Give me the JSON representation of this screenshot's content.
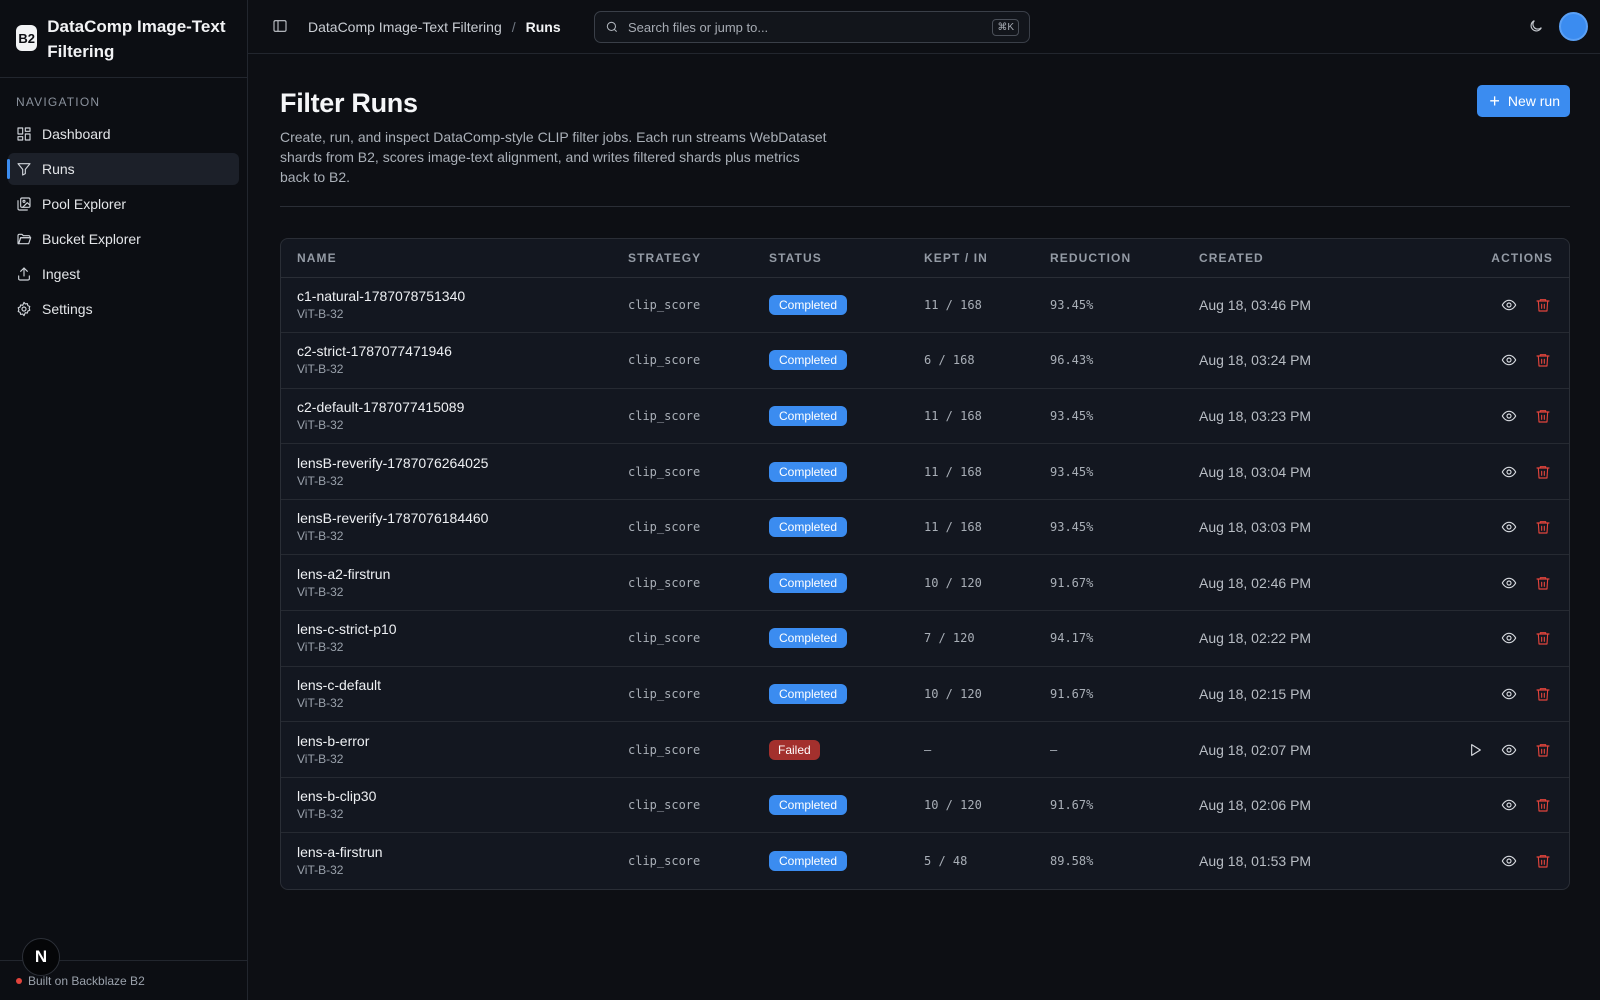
{
  "app": {
    "logo_text": "B2",
    "title": "DataComp Image-Text Filtering"
  },
  "sidebar": {
    "heading": "NAVIGATION",
    "items": [
      {
        "label": "Dashboard",
        "icon": "dashboard-icon",
        "active": false
      },
      {
        "label": "Runs",
        "icon": "filter-icon",
        "active": true
      },
      {
        "label": "Pool Explorer",
        "icon": "images-icon",
        "active": false
      },
      {
        "label": "Bucket Explorer",
        "icon": "folder-icon",
        "active": false
      },
      {
        "label": "Ingest",
        "icon": "upload-icon",
        "active": false
      },
      {
        "label": "Settings",
        "icon": "gear-icon",
        "active": false
      }
    ],
    "footer": "Built on Backblaze B2",
    "n_badge": "N"
  },
  "topbar": {
    "breadcrumb_root": "DataComp Image-Text Filtering",
    "breadcrumb_sep": "/",
    "breadcrumb_current": "Runs",
    "search_placeholder": "Search files or jump to...",
    "search_shortcut": "⌘K"
  },
  "page": {
    "title": "Filter Runs",
    "description": "Create, run, and inspect DataComp-style CLIP filter jobs. Each run streams WebDataset shards from B2, scores image-text alignment, and writes filtered shards plus metrics back to B2.",
    "new_run_label": "New run"
  },
  "table": {
    "columns": [
      "NAME",
      "STRATEGY",
      "STATUS",
      "KEPT / IN",
      "REDUCTION",
      "CREATED",
      "ACTIONS"
    ],
    "rows": [
      {
        "name": "c1-natural-1787078751340",
        "model": "ViT-B-32",
        "strategy": "clip_score",
        "status": "Completed",
        "kept_in": "11 / 168",
        "reduction": "93.45%",
        "created": "Aug 18, 03:46 PM",
        "can_rerun": false
      },
      {
        "name": "c2-strict-1787077471946",
        "model": "ViT-B-32",
        "strategy": "clip_score",
        "status": "Completed",
        "kept_in": "6 / 168",
        "reduction": "96.43%",
        "created": "Aug 18, 03:24 PM",
        "can_rerun": false
      },
      {
        "name": "c2-default-1787077415089",
        "model": "ViT-B-32",
        "strategy": "clip_score",
        "status": "Completed",
        "kept_in": "11 / 168",
        "reduction": "93.45%",
        "created": "Aug 18, 03:23 PM",
        "can_rerun": false
      },
      {
        "name": "lensB-reverify-1787076264025",
        "model": "ViT-B-32",
        "strategy": "clip_score",
        "status": "Completed",
        "kept_in": "11 / 168",
        "reduction": "93.45%",
        "created": "Aug 18, 03:04 PM",
        "can_rerun": false
      },
      {
        "name": "lensB-reverify-1787076184460",
        "model": "ViT-B-32",
        "strategy": "clip_score",
        "status": "Completed",
        "kept_in": "11 / 168",
        "reduction": "93.45%",
        "created": "Aug 18, 03:03 PM",
        "can_rerun": false
      },
      {
        "name": "lens-a2-firstrun",
        "model": "ViT-B-32",
        "strategy": "clip_score",
        "status": "Completed",
        "kept_in": "10 / 120",
        "reduction": "91.67%",
        "created": "Aug 18, 02:46 PM",
        "can_rerun": false
      },
      {
        "name": "lens-c-strict-p10",
        "model": "ViT-B-32",
        "strategy": "clip_score",
        "status": "Completed",
        "kept_in": "7 / 120",
        "reduction": "94.17%",
        "created": "Aug 18, 02:22 PM",
        "can_rerun": false
      },
      {
        "name": "lens-c-default",
        "model": "ViT-B-32",
        "strategy": "clip_score",
        "status": "Completed",
        "kept_in": "10 / 120",
        "reduction": "91.67%",
        "created": "Aug 18, 02:15 PM",
        "can_rerun": false
      },
      {
        "name": "lens-b-error",
        "model": "ViT-B-32",
        "strategy": "clip_score",
        "status": "Failed",
        "kept_in": "—",
        "reduction": "—",
        "created": "Aug 18, 02:07 PM",
        "can_rerun": true
      },
      {
        "name": "lens-b-clip30",
        "model": "ViT-B-32",
        "strategy": "clip_score",
        "status": "Completed",
        "kept_in": "10 / 120",
        "reduction": "91.67%",
        "created": "Aug 18, 02:06 PM",
        "can_rerun": false
      },
      {
        "name": "lens-a-firstrun",
        "model": "ViT-B-32",
        "strategy": "clip_score",
        "status": "Completed",
        "kept_in": "5 / 48",
        "reduction": "89.58%",
        "created": "Aug 18, 01:53 PM",
        "can_rerun": false
      }
    ]
  },
  "colors": {
    "accent": "#3b8cf0",
    "danger": "#e2443c",
    "failed_badge": "#a3302d"
  }
}
